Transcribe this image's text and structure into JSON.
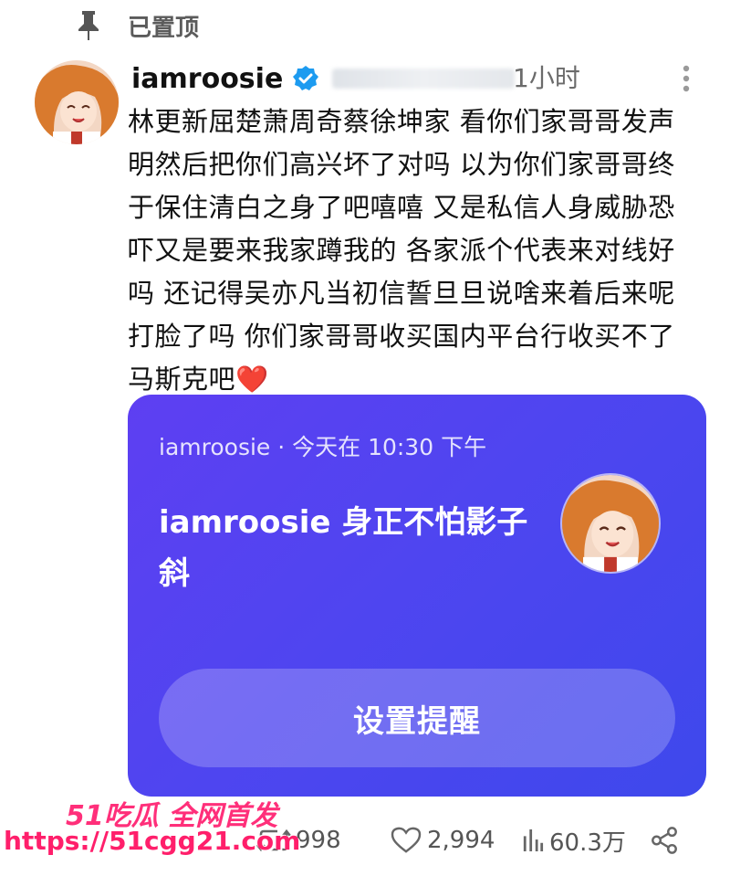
{
  "pinned": {
    "label": "已置顶",
    "icon": "pin-icon"
  },
  "post": {
    "username": "iamroosie",
    "verified_icon": "verified-badge-icon",
    "time_ago": "1小时",
    "text": "林更新屈楚萧周奇蔡徐坤家 看你们家哥哥发声明然后把你们高兴坏了对吗 以为你们家哥哥终于保住清白之身了吧嘻嘻 又是私信人身威胁恐吓又是要来我家蹲我的 各家派个代表来对线好吗 还记得吴亦凡当初信誓旦旦说啥来着后来呢打脸了吗 你们家哥哥收买国内平台行收买不了马斯克吧",
    "emoji": "❤️"
  },
  "card": {
    "meta": "iamroosie · 今天在 10:30 下午",
    "title": "iamroosie 身正不怕影子斜",
    "button_label": "设置提醒",
    "background_color": "#5243ef"
  },
  "actions": {
    "repost_count": "998",
    "like_count": "2,994",
    "view_count": "60.3万"
  },
  "watermark": {
    "logo": "51吃瓜 全网首发",
    "url": "https://51cgg21.com"
  }
}
